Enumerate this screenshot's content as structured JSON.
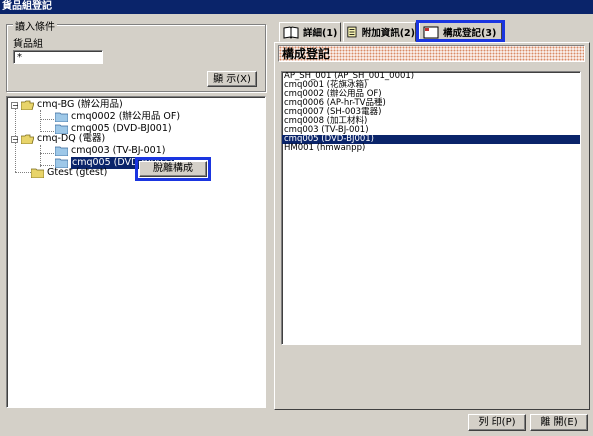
{
  "window": {
    "title": "貨品組登記"
  },
  "criteria": {
    "legend": "讀入條件",
    "field_label": "貨品組",
    "input_value": "*",
    "display_button": "顯 示(X)"
  },
  "tree": {
    "nodes": [
      {
        "label": "cmq-BG  (辦公用品)"
      },
      {
        "label": "cmq0002  (辦公用品 OF)"
      },
      {
        "label": "cmq005  (DVD-BJ001)"
      },
      {
        "label": "cmq-DQ  (電器)"
      },
      {
        "label": "cmq003  (TV-BJ-001)"
      },
      {
        "label": "cmq005  (DVD-BJ001)"
      },
      {
        "label": "Gtest  (gtest)"
      }
    ],
    "context_button": "脫離構成"
  },
  "tabs": [
    {
      "label": "詳細(1)",
      "icon": "book-icon"
    },
    {
      "label": "附加資訊(2)",
      "icon": "notes-icon"
    },
    {
      "label": "構成登記(3)",
      "icon": "card-icon"
    }
  ],
  "composition": {
    "header": "構成登記",
    "items": [
      "AP_SH_001  (AP_SH_001_0001)",
      "cmq0001  (花旗冰箱)",
      "cmq0002  (辦公用品 OF)",
      "cmq0006  (AP-hr-TV品種)",
      "cmq0007  (SH-003電器)",
      "cmq0008  (加工材料)",
      "cmq003  (TV-BJ-001)",
      "cmq005  (DVD-BJ001)",
      "HM001  (hmwanpp)"
    ],
    "selected_index": 7
  },
  "footer": {
    "print_button": "列 印(P)",
    "close_button": "離 開(E)"
  },
  "colors": {
    "face": "#d4d0c8",
    "selection": "#0a246a",
    "highlight_frame": "#1a35e0",
    "folder": "#e8d46a"
  }
}
